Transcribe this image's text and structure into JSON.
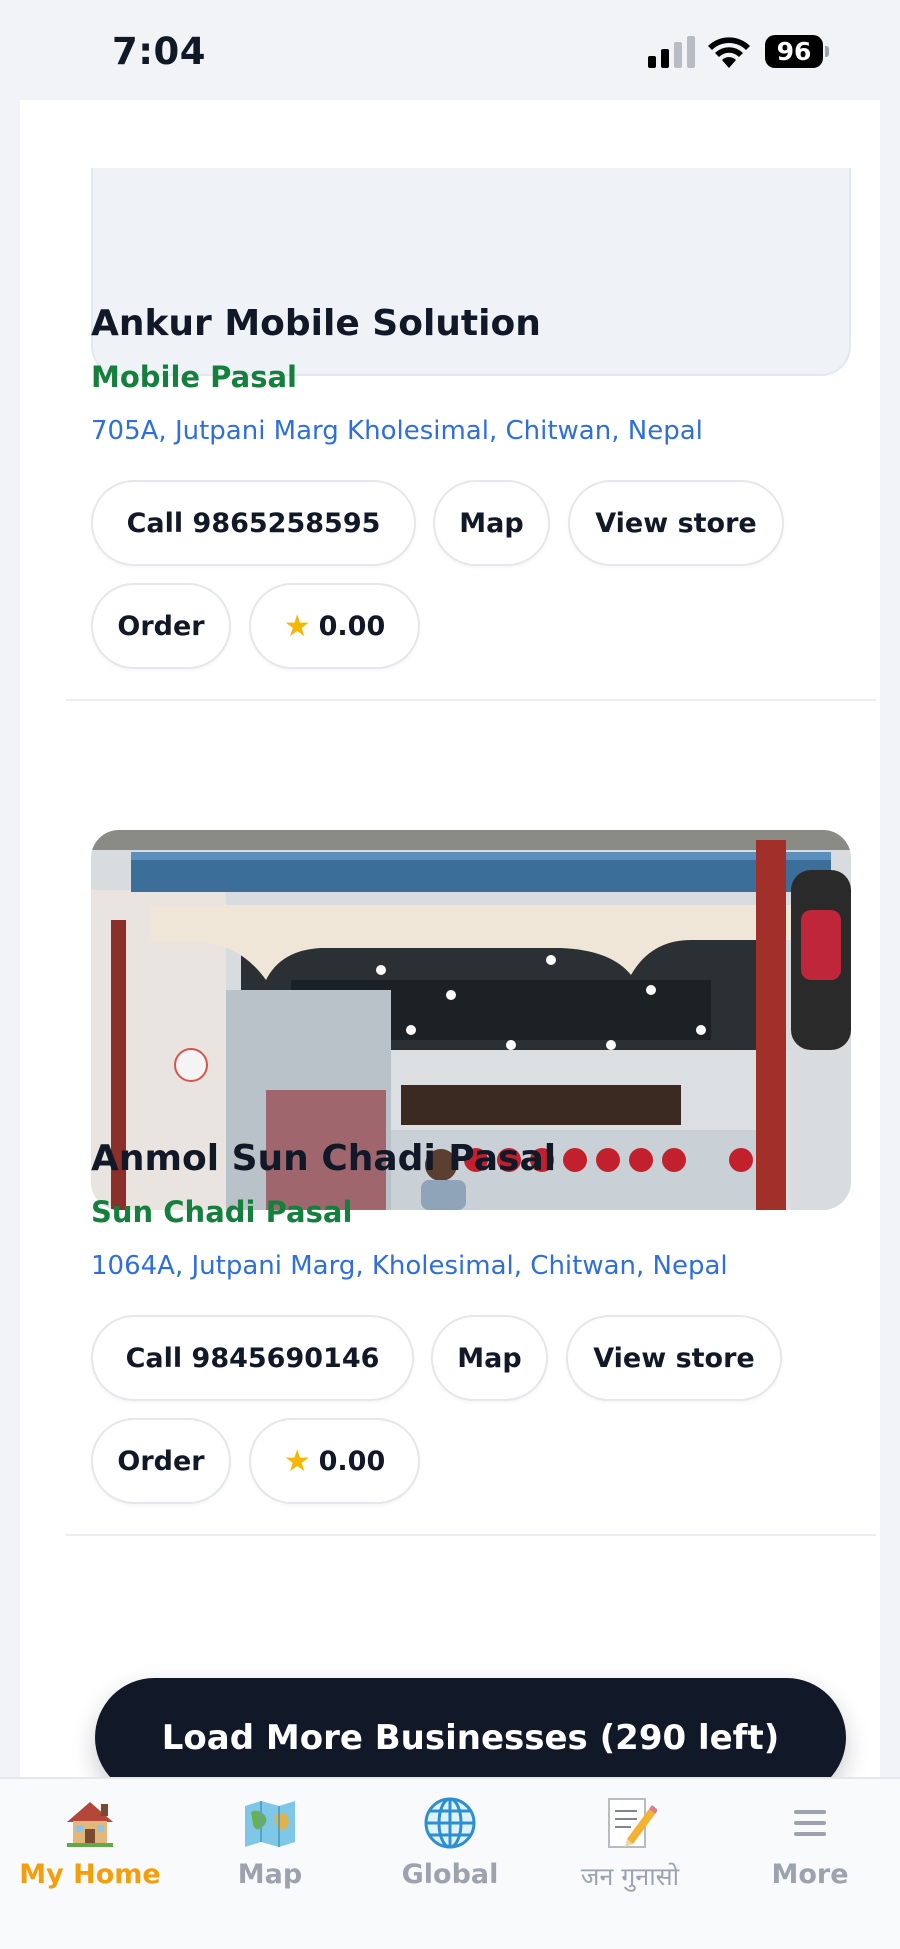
{
  "status_bar": {
    "time": "7:04",
    "battery": "96"
  },
  "businesses": [
    {
      "name": "Ankur Mobile Solution",
      "category": "Mobile Pasal",
      "address": "705A, Jutpani Marg Kholesimal, Chitwan, Nepal",
      "call_label": "Call 9865258595",
      "map_label": "Map",
      "view_label": "View store",
      "order_label": "Order",
      "rating": "0.00"
    },
    {
      "name": "Anmol Sun Chadi Pasal",
      "category": "Sun Chadi Pasal",
      "address": "1064A, Jutpani Marg, Kholesimal, Chitwan, Nepal",
      "call_label": "Call 9845690146",
      "map_label": "Map",
      "view_label": "View store",
      "order_label": "Order",
      "rating": "0.00"
    }
  ],
  "load_more_label": "Load More Businesses (290 left)",
  "tabs": [
    {
      "label": "My Home",
      "icon": "house-icon",
      "active": true
    },
    {
      "label": "Map",
      "icon": "map-icon",
      "active": false
    },
    {
      "label": "Global",
      "icon": "globe-icon",
      "active": false
    },
    {
      "label": "जन गुनासो",
      "icon": "memo-icon",
      "active": false
    },
    {
      "label": "More",
      "icon": "menu-icon",
      "active": false
    }
  ],
  "colors": {
    "active_tab": "#f59e0b",
    "category": "#15803d",
    "address": "#2f6fdb",
    "load_more_bg": "#111827"
  }
}
